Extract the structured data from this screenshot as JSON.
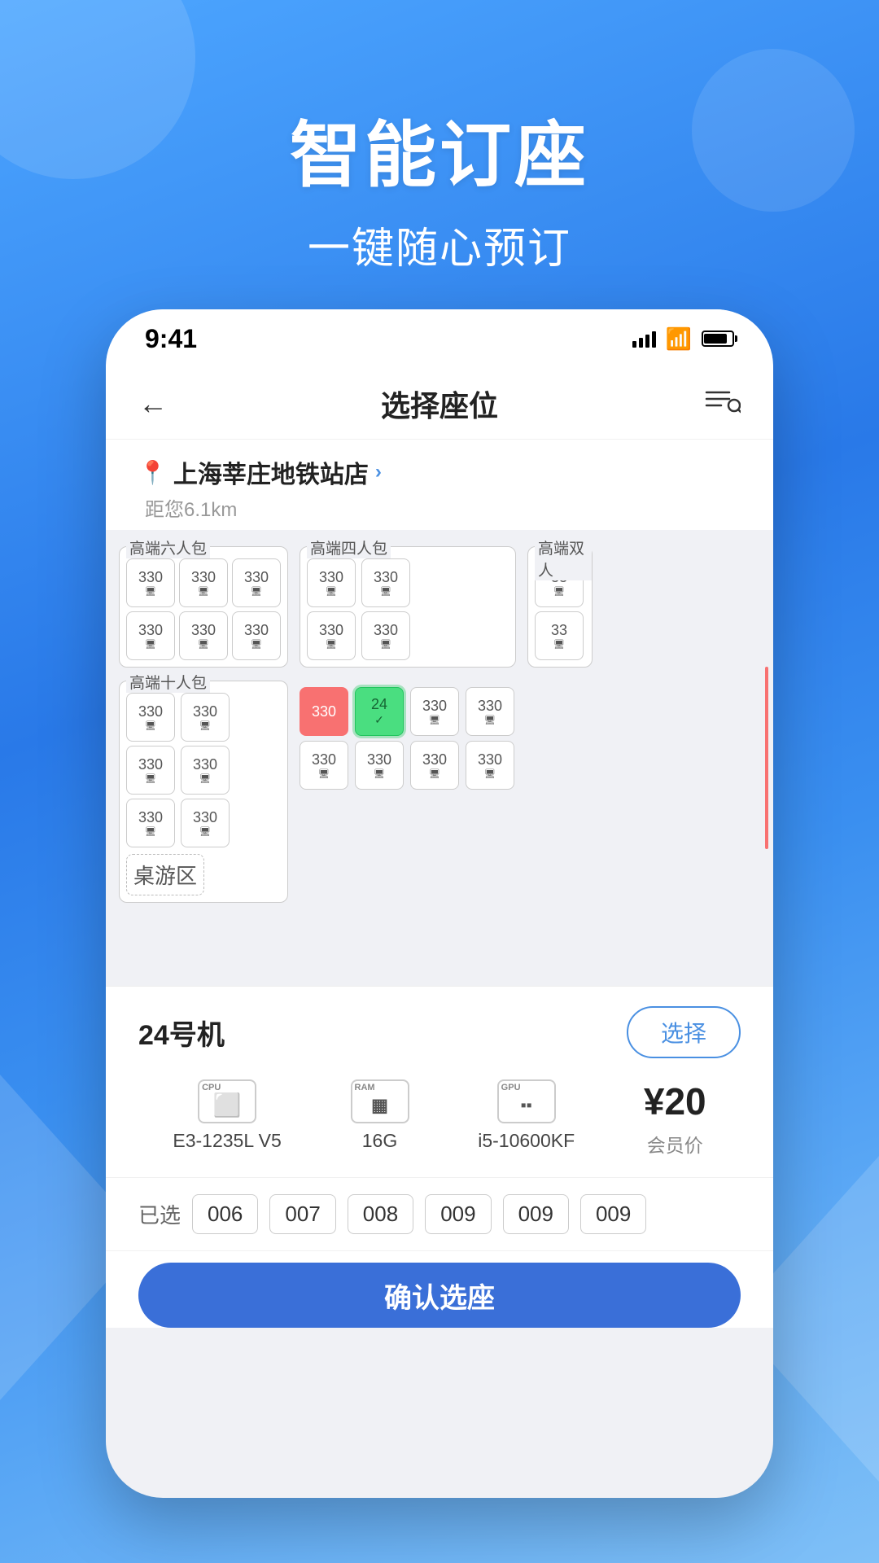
{
  "background": {
    "gradient_start": "#4da6ff",
    "gradient_end": "#2979e8"
  },
  "hero": {
    "title": "智能订座",
    "subtitle": "一键随心预订"
  },
  "phone": {
    "status_bar": {
      "time": "9:41",
      "signal_bars": [
        3,
        5,
        7,
        9,
        11
      ],
      "wifi": "wifi",
      "battery": "battery"
    },
    "nav": {
      "back_icon": "←",
      "title": "选择座位",
      "right_icon": "≡Q"
    },
    "location": {
      "name": "上海莘庄地铁站店",
      "arrow": "›",
      "distance": "距您6.1km"
    },
    "seat_map": {
      "sections": [
        {
          "id": "section-6person",
          "label": "高端六人包",
          "rows": [
            [
              "330",
              "330",
              "330"
            ],
            [
              "330",
              "330",
              "330"
            ]
          ]
        },
        {
          "id": "section-4person",
          "label": "高端四人包",
          "rows": [
            [
              "330",
              "330"
            ],
            [
              "330",
              "330"
            ]
          ]
        },
        {
          "id": "section-2person",
          "label": "高端双人",
          "rows": [
            [
              "33"
            ],
            [
              "33"
            ]
          ]
        },
        {
          "id": "section-10person",
          "label": "高端十人包",
          "rows": [
            [
              "330",
              "330",
              "330",
              "330",
              "330"
            ],
            [
              "330",
              "330",
              "330",
              "330",
              "330"
            ]
          ]
        }
      ],
      "special_seats": {
        "occupied": {
          "number": "330",
          "color": "red"
        },
        "selected": {
          "number": "24",
          "color": "green"
        }
      },
      "board_game_area": "桌游区"
    },
    "machine_info": {
      "machine_id": "24号机",
      "select_button": "选择",
      "specs": [
        {
          "type": "CPU",
          "value": "E3-1235L V5"
        },
        {
          "type": "RAM",
          "value": "16G"
        },
        {
          "type": "GPU",
          "value": "i5-10600KF"
        }
      ],
      "price": "¥20",
      "price_label": "会员价"
    },
    "selected_seats": {
      "label": "已选",
      "seats": [
        "006",
        "007",
        "008",
        "009",
        "009",
        "009"
      ]
    },
    "confirm_button": "确认选座"
  }
}
